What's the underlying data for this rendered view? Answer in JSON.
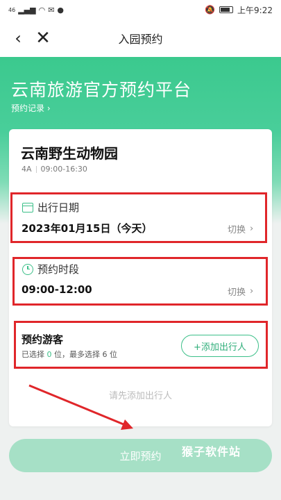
{
  "status": {
    "signal": "46",
    "time": "上午9:22"
  },
  "nav": {
    "title": "入园预约"
  },
  "hero": {
    "title": "云南旅游官方预约平台",
    "records_link": "预约记录 ›"
  },
  "park": {
    "name": "云南野生动物园",
    "level": "4A",
    "hours": "09:00-16:30"
  },
  "date_section": {
    "label": "出行日期",
    "value": "2023年01月15日（今天）",
    "switch_label": "切换"
  },
  "time_section": {
    "label": "预约时段",
    "value": "09:00-12:00",
    "switch_label": "切换"
  },
  "guests": {
    "title": "预约游客",
    "selected_prefix": "已选择 ",
    "selected_count": "0",
    "selected_mid": " 位，最多选择 ",
    "max_count": "6",
    "selected_suffix": " 位",
    "add_button": "+添加出行人"
  },
  "hint": "请先添加出行人",
  "book_button": "立即预约",
  "watermark": "猴子软件站",
  "colors": {
    "brand": "#3bc98e",
    "highlight": "#e0262a",
    "button_disabled": "#a6e0c6"
  }
}
